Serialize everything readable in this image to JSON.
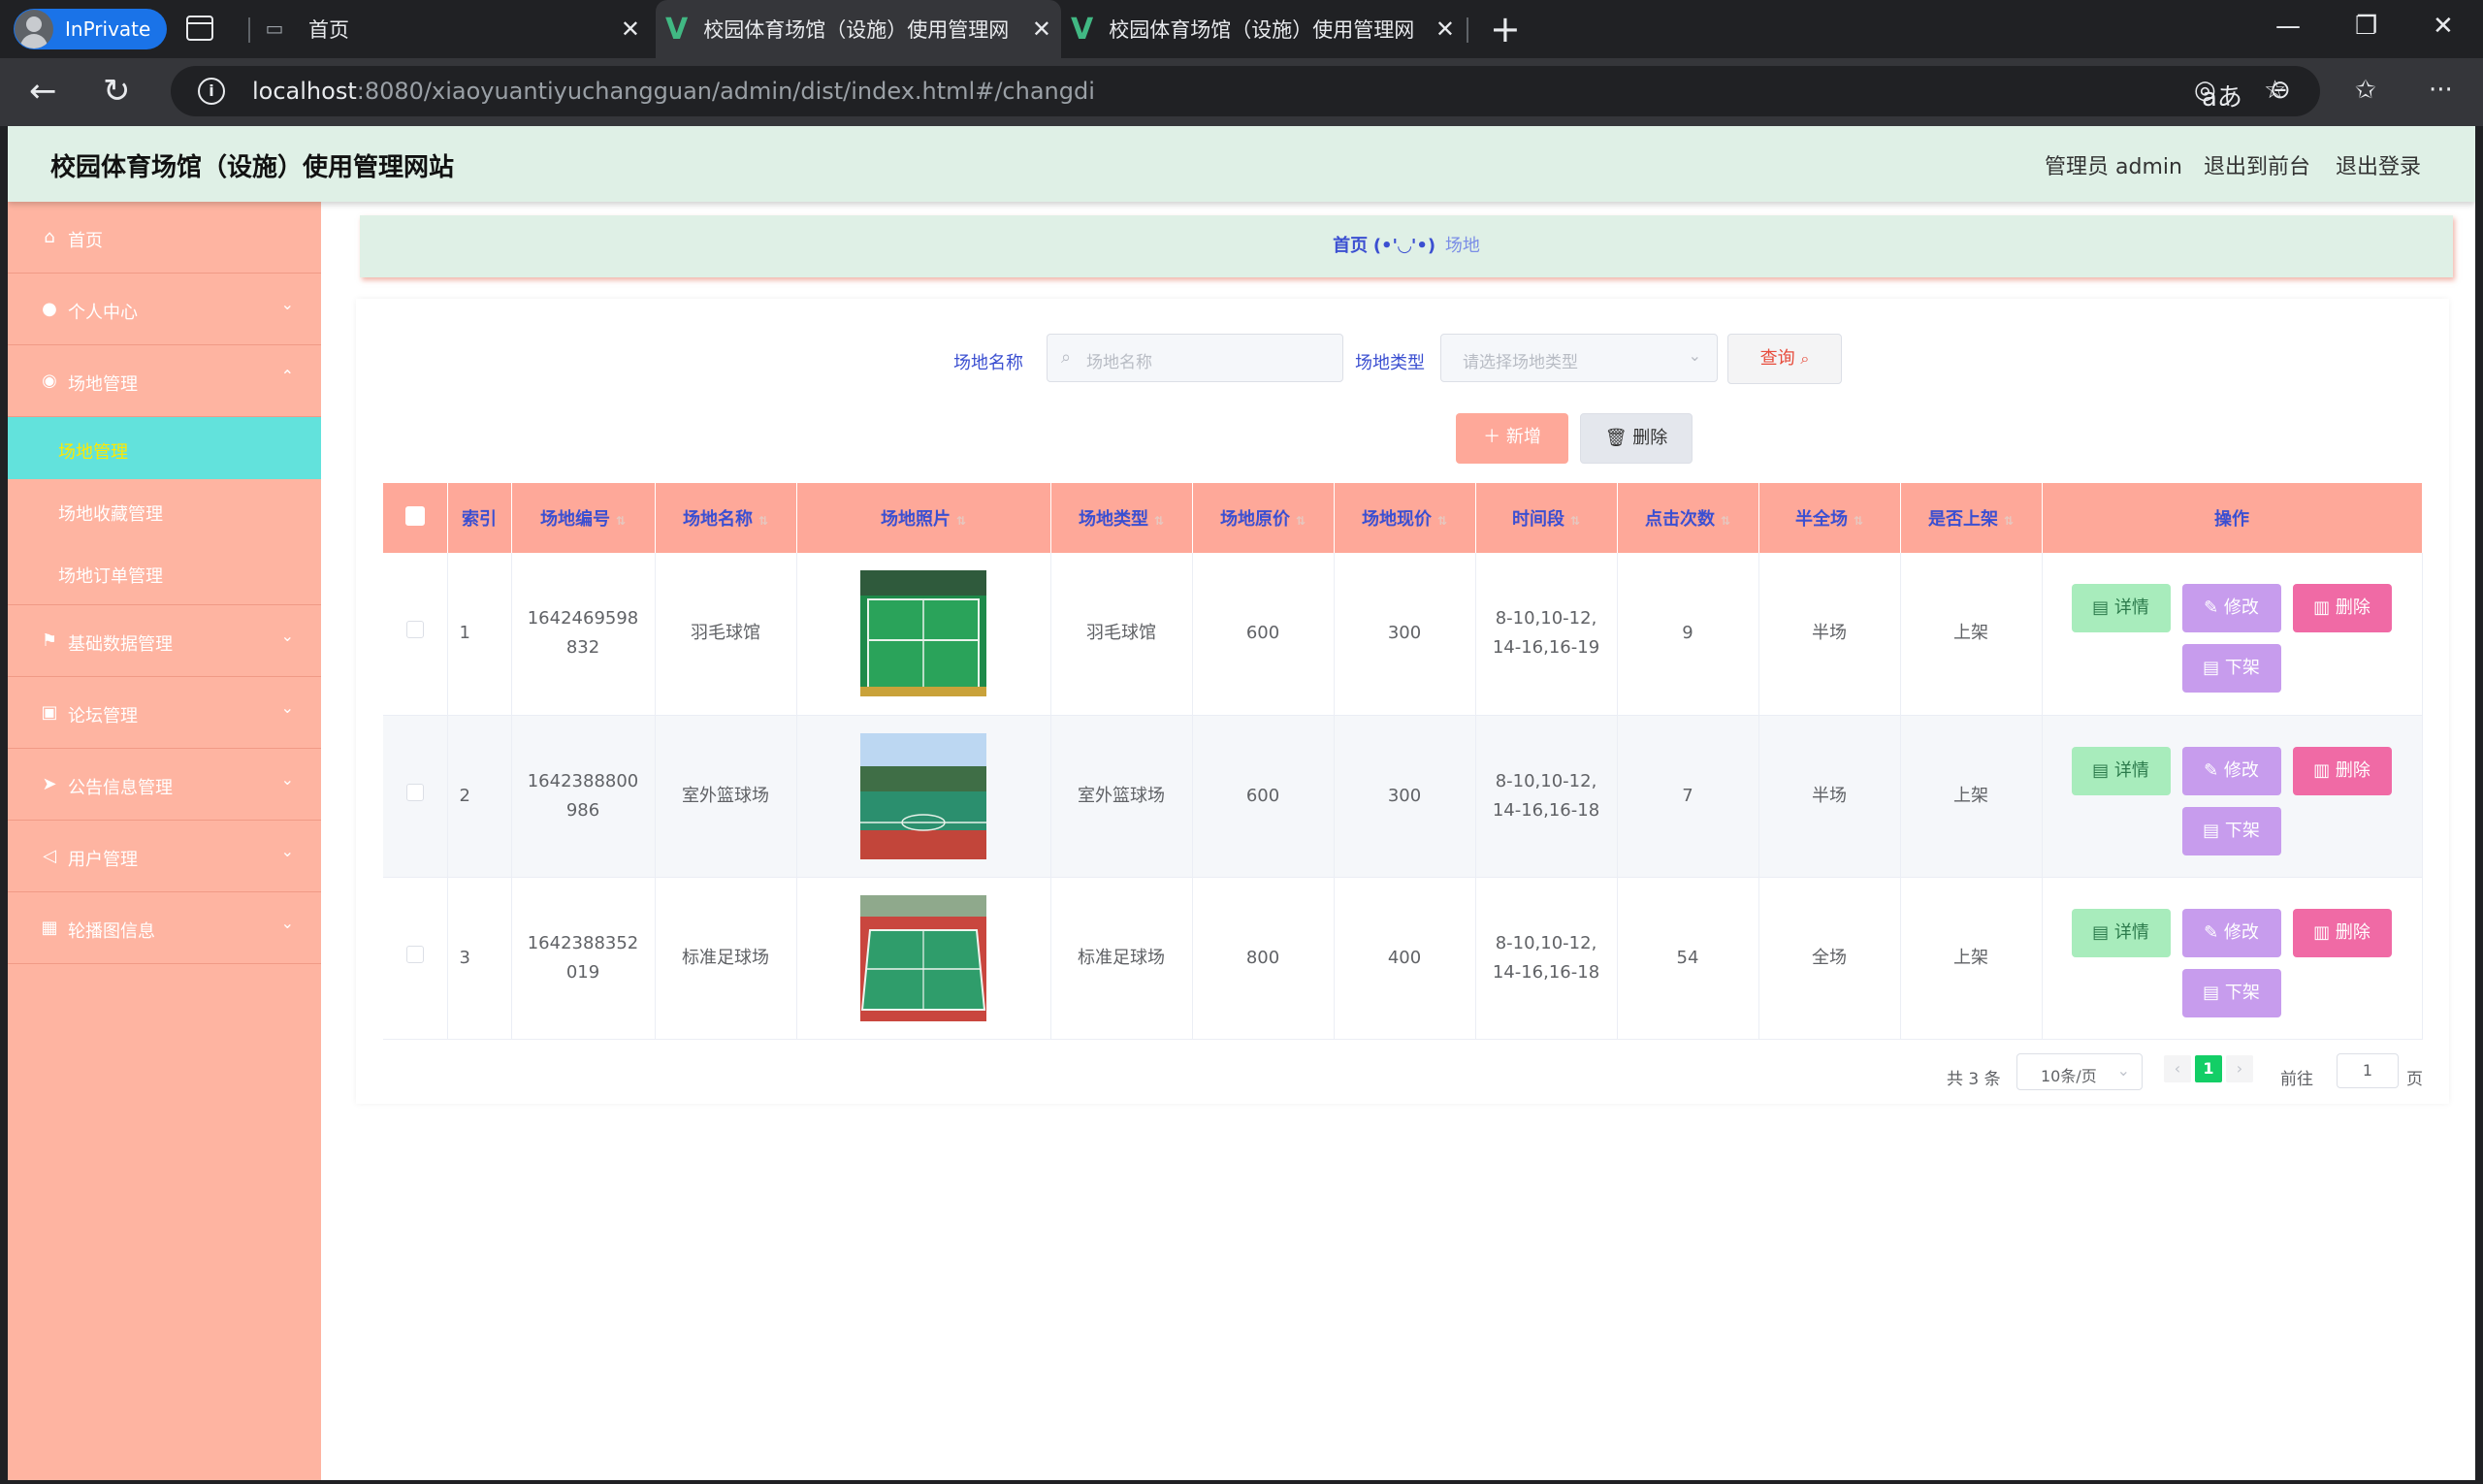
{
  "browser": {
    "inprivate_label": "InPrivate",
    "tabs": [
      {
        "title": "首页"
      },
      {
        "title": "校园体育场馆（设施）使用管理网"
      },
      {
        "title": "校园体育场馆（设施）使用管理网"
      }
    ],
    "url_host": "localhost",
    "url_rest": ":8080/xiaoyuantiyuchangguan/admin/dist/index.html#/changdi"
  },
  "header": {
    "title": "校园体育场馆（设施）使用管理网站",
    "links": [
      "管理员 admin",
      "退出到前台",
      "退出登录"
    ]
  },
  "sidebar": {
    "items": [
      {
        "label": "首页",
        "icon": "home-icon"
      },
      {
        "label": "个人中心",
        "icon": "user-icon"
      },
      {
        "label": "场地管理",
        "icon": "location-icon"
      },
      {
        "label": "基础数据管理",
        "icon": "flag-icon"
      },
      {
        "label": "论坛管理",
        "icon": "chart-icon"
      },
      {
        "label": "公告信息管理",
        "icon": "send-icon"
      },
      {
        "label": "用户管理",
        "icon": "navigation-icon"
      },
      {
        "label": "轮播图信息",
        "icon": "grid-icon"
      }
    ],
    "subitems": [
      "场地管理",
      "场地收藏管理",
      "场地订单管理"
    ]
  },
  "breadcrumb": {
    "home": "首页",
    "face": "(•'◡'•)",
    "current": "场地"
  },
  "search": {
    "name_label": "场地名称",
    "name_placeholder": "场地名称",
    "type_label": "场地类型",
    "type_placeholder": "请选择场地类型",
    "query_label": "查询"
  },
  "actions": {
    "add_label": "新增",
    "delete_label": "删除"
  },
  "table": {
    "columns": [
      "索引",
      "场地编号",
      "场地名称",
      "场地照片",
      "场地类型",
      "场地原价",
      "场地现价",
      "时间段",
      "点击次数",
      "半全场",
      "是否上架",
      "操作"
    ],
    "rows": [
      {
        "index": "1",
        "code": "1642469598832",
        "name": "羽毛球馆",
        "type": "羽毛球馆",
        "orig": "600",
        "now": "300",
        "time": "8-10,10-12,14-16,16-19",
        "clicks": "9",
        "half": "半场",
        "shelf": "上架"
      },
      {
        "index": "2",
        "code": "1642388800986",
        "name": "室外篮球场",
        "type": "室外篮球场",
        "orig": "600",
        "now": "300",
        "time": "8-10,10-12,14-16,16-18",
        "clicks": "7",
        "half": "半场",
        "shelf": "上架"
      },
      {
        "index": "3",
        "code": "1642388352019",
        "name": "标准足球场",
        "type": "标准足球场",
        "orig": "800",
        "now": "400",
        "time": "8-10,10-12,14-16,16-18",
        "clicks": "54",
        "half": "全场",
        "shelf": "上架"
      }
    ],
    "ops": {
      "detail": "详情",
      "edit": "修改",
      "delete": "删除",
      "offshelf": "下架"
    }
  },
  "pagination": {
    "total": "共 3 条",
    "page_size": "10条/页",
    "current": "1",
    "goto_prefix": "前往",
    "goto_value": "1",
    "goto_suffix": "页"
  }
}
